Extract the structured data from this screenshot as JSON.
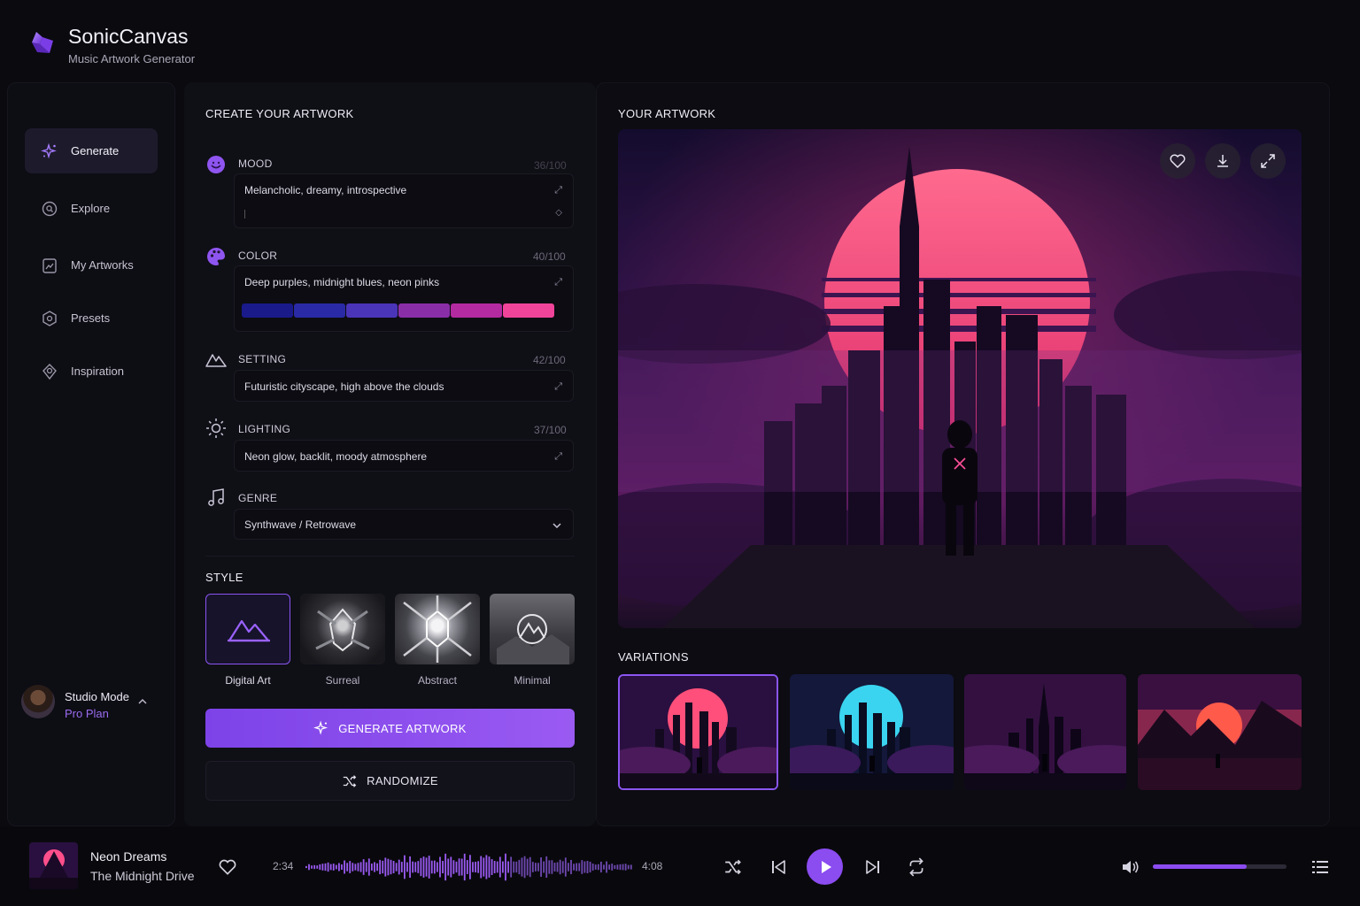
{
  "app": {
    "title": "SonicCanvas",
    "subtitle": "Music Artwork Generator"
  },
  "sidebar": {
    "items": [
      {
        "label": "Generate",
        "icon": "sparkle-icon",
        "active": true
      },
      {
        "label": "Explore",
        "icon": "search-icon"
      },
      {
        "label": "My Artworks",
        "icon": "artwork-folder-icon"
      },
      {
        "label": "Presets",
        "icon": "presets-icon"
      },
      {
        "label": "Inspiration",
        "icon": "lightbulb-icon"
      }
    ],
    "user": {
      "name": "Studio Mode",
      "plan": "Pro Plan"
    }
  },
  "create": {
    "title": "CREATE YOUR ARTWORK",
    "mood": {
      "label": "MOOD",
      "count": "36/100",
      "value": "Melancholic, dreamy, introspective"
    },
    "color": {
      "label": "COLOR",
      "count": "40/100",
      "value": "Deep purples, midnight blues, neon pinks",
      "swatches": [
        "#1a1a8a",
        "#2a2aa6",
        "#4a34b8",
        "#8a2ea8",
        "#b42aa0",
        "#f0449a"
      ]
    },
    "setting": {
      "label": "SETTING",
      "count": "42/100",
      "value": "Futuristic cityscape, high above the clouds"
    },
    "lighting": {
      "label": "LIGHTING",
      "count": "37/100",
      "value": "Neon glow, backlit, moody atmosphere"
    },
    "genre": {
      "label": "GENRE",
      "value": "Synthwave / Retrowave"
    },
    "style": {
      "title": "STYLE",
      "options": [
        {
          "label": "Digital Art",
          "selected": true
        },
        {
          "label": "Surreal"
        },
        {
          "label": "Abstract"
        },
        {
          "label": "Minimal"
        }
      ]
    },
    "generate_label": "GENERATE ARTWORK",
    "randomize_label": "RANDOMIZE"
  },
  "artwork": {
    "title": "YOUR ARTWORK",
    "variations_title": "VARIATIONS",
    "actions": [
      "heart-icon",
      "download-icon",
      "expand-icon"
    ]
  },
  "player": {
    "track_title": "Neon Dreams",
    "artist": "The Midnight Drive",
    "elapsed": "2:34",
    "duration": "4:08",
    "progress": 0.62,
    "volume": 0.7
  },
  "colors": {
    "accent": "#8b4cf0",
    "pink": "#ff4f8b",
    "bg": "#0a0a0f"
  }
}
